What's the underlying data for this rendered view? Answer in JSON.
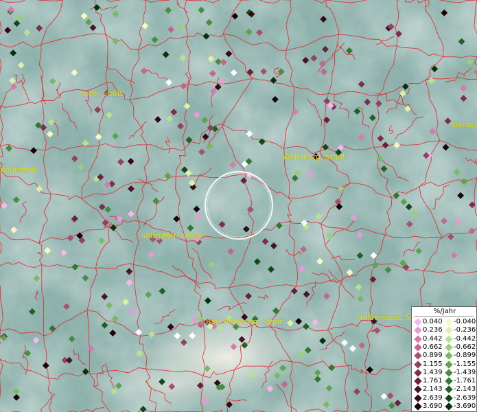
{
  "map": {
    "cities": [
      {
        "name": "Celle, Stadt"
      },
      {
        "name": "Wolfsburg, Stadt"
      },
      {
        "name": "Salzgitter, Stadt"
      },
      {
        "name": "Bad Harzburg, Stadt"
      },
      {
        "name": "Halberstadt, Stadt"
      },
      {
        "name": "Gardele"
      },
      {
        "name": "auptstadt"
      }
    ],
    "legend": {
      "title": "%/Jahr",
      "positive": [
        {
          "label": "0.040",
          "color": "#f5b8ee"
        },
        {
          "label": "0.236",
          "color": "#e79ad6"
        },
        {
          "label": "0.442",
          "color": "#d47aae"
        },
        {
          "label": "0.662",
          "color": "#c06690"
        },
        {
          "label": "0.899",
          "color": "#a84f74"
        },
        {
          "label": "1.155",
          "color": "#94405f"
        },
        {
          "label": "1.439",
          "color": "#7c2f4c"
        },
        {
          "label": "1.761",
          "color": "#66223a"
        },
        {
          "label": "2.143",
          "color": "#4a1428"
        },
        {
          "label": "2.639",
          "color": "#32091a"
        },
        {
          "label": "3.690",
          "color": "#1a0008"
        }
      ],
      "negative": [
        {
          "label": "-0.040",
          "color": "#f4fbbf"
        },
        {
          "label": "-0.236",
          "color": "#d9f2a8"
        },
        {
          "label": "-0.442",
          "color": "#b8e28e"
        },
        {
          "label": "-0.662",
          "color": "#98cf78"
        },
        {
          "label": "-0.899",
          "color": "#78ba62"
        },
        {
          "label": "-1.155",
          "color": "#5da44e"
        },
        {
          "label": "-1.439",
          "color": "#468d3e"
        },
        {
          "label": "-1.761",
          "color": "#327731"
        },
        {
          "label": "-2.143",
          "color": "#206125"
        },
        {
          "label": "-2.639",
          "color": "#114a19"
        },
        {
          "label": "-3.690",
          "color": "#04320d"
        }
      ]
    },
    "colors": {
      "terrain": "#8fb3ad",
      "borders": "#e8252b",
      "labels": "#e8e400",
      "focus_ring": "#ffffff"
    }
  }
}
